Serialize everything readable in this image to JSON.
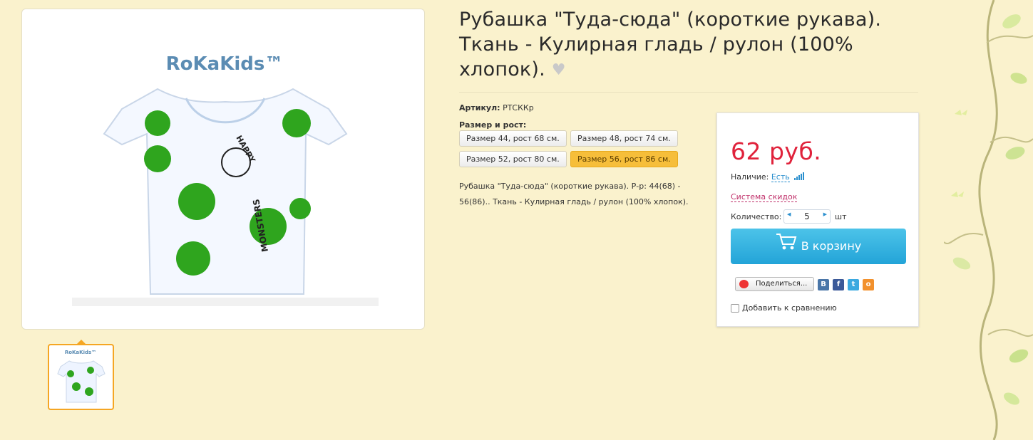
{
  "product": {
    "title": "Рубашка \"Туда-сюда\" (короткие рукава). Ткань - Кулирная гладь / рулон (100% хлопок).",
    "sku_label": "Артикул:",
    "sku_value": "РТСККр",
    "sizes_label": "Размер и рост:",
    "sizes": [
      {
        "label": "Размер 44, рост 68 см.",
        "selected": false
      },
      {
        "label": "Размер 48, рост 74 см.",
        "selected": false
      },
      {
        "label": "Размер 52, рост 80 см.",
        "selected": false
      },
      {
        "label": "Размер 56, рост 86 см.",
        "selected": true
      }
    ],
    "description": "Рубашка \"Туда-сюда\" (короткие рукава). Р-р: 44(68) - 56(86).. Ткань - Кулирная гладь / рулон (100% хлопок).",
    "brand_logo": "RoKaKids™",
    "thumb_logo": "RoKaKids™"
  },
  "buy": {
    "price": "62 руб.",
    "availability_label": "Наличие:",
    "availability_value": "Есть",
    "discount_link": "Система скидок",
    "qty_label": "Количество:",
    "qty_value": "5",
    "qty_unit": "шт",
    "cart_button": "В корзину",
    "share_button": "Поделиться...",
    "compare_label": "Добавить к сравнению"
  },
  "colors": {
    "background": "#faf2cd",
    "price": "#e0223b",
    "cart_button": "#2aa9dc",
    "selected_size": "#f6be3a",
    "thumb_border": "#f5a623"
  },
  "icons": [
    "heart-icon",
    "cart-icon",
    "signal-bars-icon",
    "vk-icon",
    "facebook-icon",
    "twitter-icon",
    "odnoklassniki-icon",
    "yandex-share-icon"
  ]
}
